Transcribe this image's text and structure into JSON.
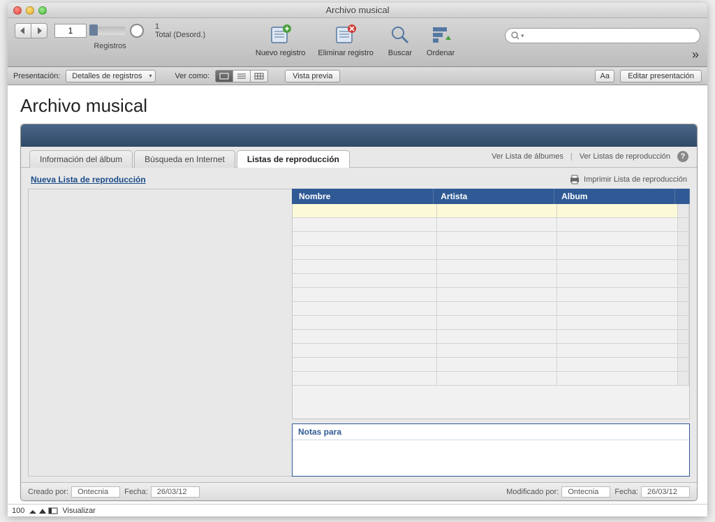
{
  "window": {
    "title": "Archivo musical"
  },
  "toolbar": {
    "record_number": "1",
    "total_text": "1",
    "sort_state": "Total (Desord.)",
    "registros_label": "Registros",
    "new_record": "Nuevo registro",
    "delete_record": "Eliminar registro",
    "search": "Buscar",
    "sort": "Ordenar",
    "search_placeholder": "",
    "search_prefix": "Q"
  },
  "format_bar": {
    "layout_label": "Presentación:",
    "layout_value": "Detalles de registros",
    "view_as_label": "Ver como:",
    "preview": "Vista previa",
    "aa": "Aa",
    "edit_layout": "Editar presentación"
  },
  "page": {
    "heading": "Archivo musical"
  },
  "tabs": {
    "album_info": "Información del álbum",
    "internet_search": "Búsqueda en Internet",
    "playlists": "Listas de reproducción"
  },
  "shelf_links": {
    "view_albums": "Ver Lista de álbumes",
    "view_playlists": "Ver Listas de reproducción"
  },
  "body": {
    "new_playlist": "Nueva Lista de reproducción",
    "print_playlist": "Imprimir Lista de reproducción",
    "col_nombre": "Nombre",
    "col_artista": "Artista",
    "col_album": "Album",
    "notes_label": "Notas para"
  },
  "footer": {
    "created_by_label": "Creado por:",
    "created_by_value": "Ontecnia",
    "created_date_label": "Fecha:",
    "created_date_value": "26/03/12",
    "modified_by_label": "Modificado por:",
    "modified_by_value": "Ontecnia",
    "modified_date_label": "Fecha:",
    "modified_date_value": "26/03/12"
  },
  "status": {
    "zoom": "100",
    "mode": "Visualizar"
  }
}
